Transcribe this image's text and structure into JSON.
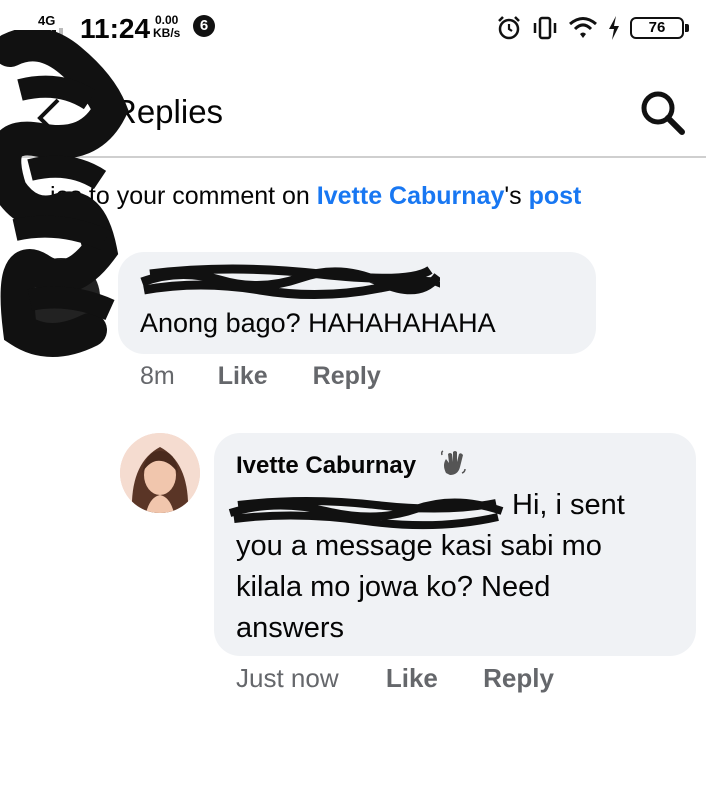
{
  "status_bar": {
    "network": "4G",
    "time": "11:24",
    "speed_value": "0.00",
    "speed_unit": "KB/s",
    "notification_count": "6",
    "battery": "76"
  },
  "header": {
    "title": "Replies"
  },
  "context": {
    "prefix": "ies to your comment on ",
    "post_author": "Ivette Caburnay",
    "suffix": "'s ",
    "post_link": "post"
  },
  "comments": [
    {
      "text": "Anong bago?  HAHAHAHAHA",
      "time": "8m",
      "like_label": "Like",
      "reply_label": "Reply"
    },
    {
      "author": "Ivette Caburnay",
      "text": "Hi, i sent you a message kasi sabi mo kilala mo jowa ko? Need answers",
      "time": "Just now",
      "like_label": "Like",
      "reply_label": "Reply"
    }
  ],
  "colors": {
    "link": "#1877f2",
    "bubble": "#f0f2f5",
    "meta": "#65676b"
  },
  "icons": [
    "back-arrow-icon",
    "search-icon",
    "alarm-icon",
    "vibrate-icon",
    "wifi-icon",
    "charging-icon",
    "wave-icon"
  ]
}
